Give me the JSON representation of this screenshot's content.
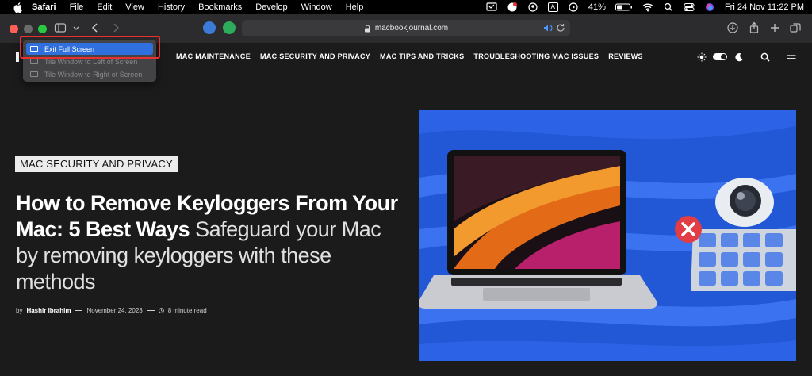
{
  "menubar": {
    "app": "Safari",
    "items": [
      "File",
      "Edit",
      "View",
      "History",
      "Bookmarks",
      "Develop",
      "Window",
      "Help"
    ],
    "input_source": "A",
    "battery": "41%",
    "datetime": "Fri 24 Nov  11:22 PM"
  },
  "toolbar": {
    "url": "macbookjournal.com"
  },
  "dropdown": {
    "items": [
      "Exit Full Screen",
      "Tile Window to Left of Screen",
      "Tile Window to Right of Screen"
    ]
  },
  "site": {
    "nav": [
      "MAC MAINTENANCE",
      "MAC SECURITY AND PRIVACY",
      "MAC TIPS AND TRICKS",
      "TROUBLESHOOTING MAC ISSUES",
      "REVIEWS"
    ],
    "category": "MAC SECURITY AND PRIVACY",
    "title": "How to Remove Keyloggers From Your Mac: 5 Best Ways",
    "subtitle": "Safeguard your Mac by removing keyloggers with these methods",
    "byline_prefix": "by",
    "author": "Hashir Ibrahim",
    "date": "November 24, 2023",
    "read_time": "8 minute read"
  },
  "colors": {
    "accent": "#2f6fde",
    "highlight": "#e8312f",
    "hero_bg": "#2257d6"
  }
}
